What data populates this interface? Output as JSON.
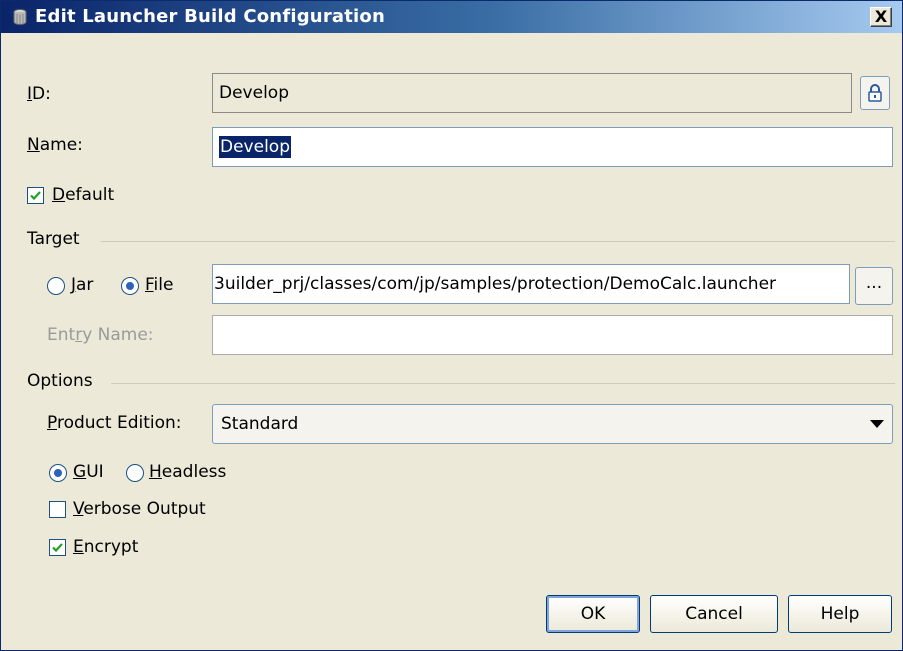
{
  "window": {
    "title": "Edit Launcher Build Configuration",
    "close_label": "X"
  },
  "id_field": {
    "label_mnemonic": "I",
    "label_rest": "D:",
    "value": "Develop"
  },
  "name_field": {
    "label_mnemonic": "N",
    "label_rest": "ame:",
    "value": "Develop"
  },
  "default_checkbox": {
    "label_mnemonic": "D",
    "label_rest": "efault",
    "checked": true
  },
  "target": {
    "section_label": "Target",
    "jar_radio": {
      "label_mnemonic": "J",
      "label_rest": "ar",
      "selected": false
    },
    "file_radio": {
      "label_mnemonic": "F",
      "label_rest": "ile",
      "selected": true
    },
    "file_path": "3uilder_prj/classes/com/jp/samples/protection/DemoCalc.launcher",
    "browse_label": "...",
    "entry_name": {
      "label_pre": "Ent",
      "label_mnemonic": "r",
      "label_rest": "y Name:",
      "value": ""
    }
  },
  "options": {
    "section_label": "Options",
    "product_edition": {
      "label_mnemonic": "P",
      "label_rest": "roduct Edition:",
      "value": "Standard"
    },
    "gui_radio": {
      "label_mnemonic": "G",
      "label_rest": "UI",
      "selected": true
    },
    "headless_radio": {
      "label_mnemonic": "H",
      "label_rest": "eadless",
      "selected": false
    },
    "verbose_checkbox": {
      "label_mnemonic": "V",
      "label_rest": "erbose Output",
      "checked": false
    },
    "encrypt_checkbox": {
      "label_mnemonic": "E",
      "label_rest": "ncrypt",
      "checked": true
    }
  },
  "buttons": {
    "ok": "OK",
    "cancel": "Cancel",
    "help": "Help"
  },
  "colors": {
    "title_gradient_start": "#0a246a",
    "selection": "#0a246a",
    "dialog_bg": "#ece9d8"
  }
}
